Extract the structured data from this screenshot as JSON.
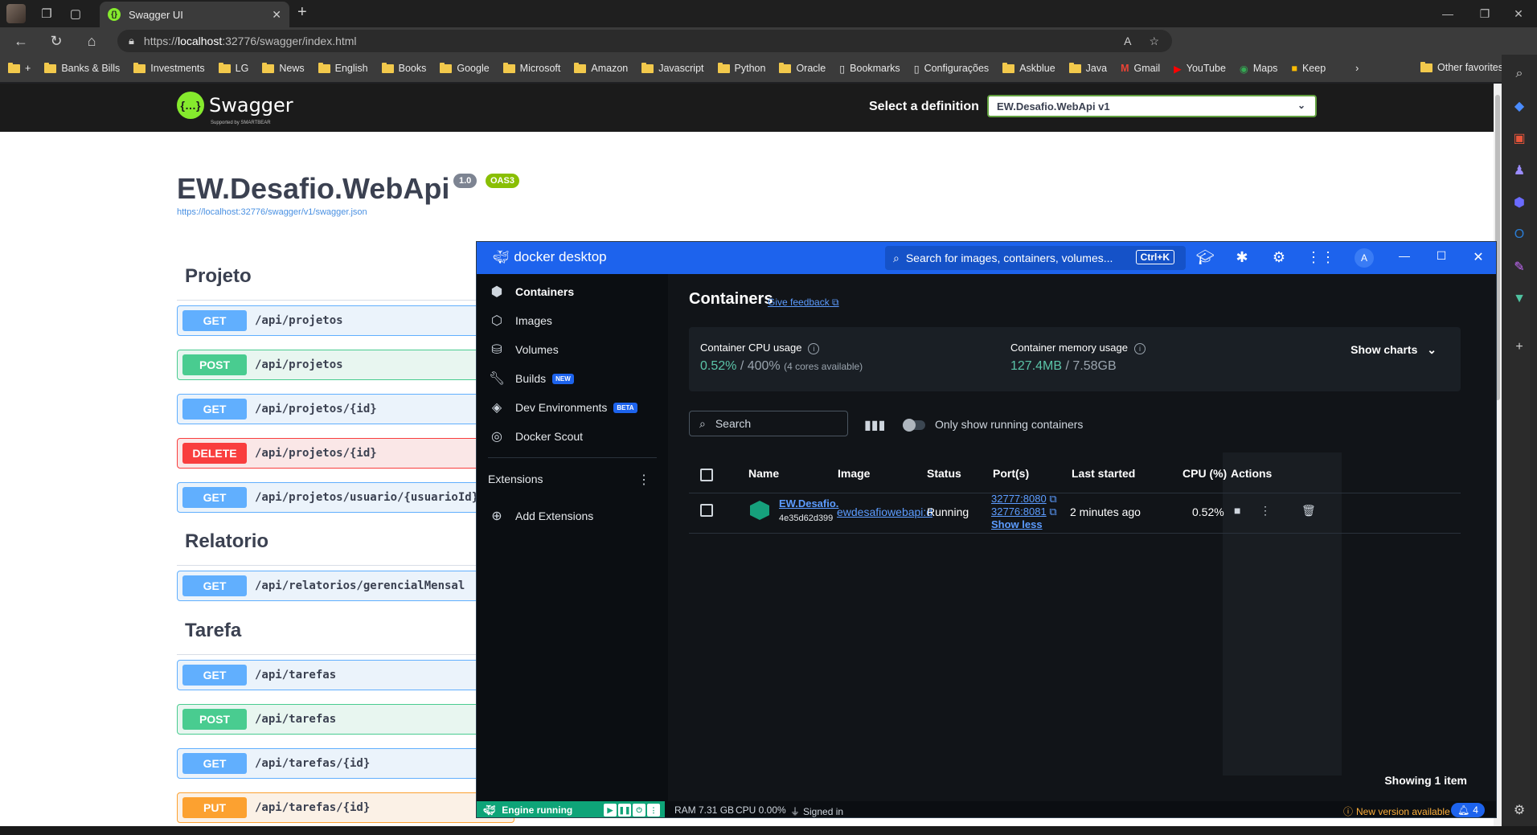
{
  "browser": {
    "tab_title": "Swagger UI",
    "url_prefix": "https://",
    "url_host": "localhost",
    "url_rest": ":32776/swagger/index.html",
    "bookmarks": [
      "Banks & Bills",
      "Investments",
      "LG",
      "News",
      "English",
      "Books",
      "Google",
      "Microsoft",
      "Amazon",
      "Javascript",
      "Python",
      "Oracle",
      "Bookmarks",
      "Configurações",
      "Askblue",
      "Java",
      "Gmail",
      "YouTube",
      "Maps",
      "Keep"
    ],
    "bookmarks_add": "+",
    "other_favorites": "Other favorites"
  },
  "swagger": {
    "logo_text": "Swagger",
    "logo_sub": "Supported by SMARTBEAR",
    "select_label": "Select a definition",
    "select_value": "EW.Desafio.WebApi v1",
    "api_title": "EW.Desafio.WebApi",
    "version_badge": "1.0",
    "oas_badge": "OAS3",
    "spec_link": "https://localhost:32776/swagger/v1/swagger.json",
    "tags": [
      "Projeto",
      "Relatorio",
      "Tarefa"
    ],
    "ops": [
      {
        "method": "GET",
        "path": "/api/projetos"
      },
      {
        "method": "POST",
        "path": "/api/projetos"
      },
      {
        "method": "GET",
        "path": "/api/projetos/{id}"
      },
      {
        "method": "DELETE",
        "path": "/api/projetos/{id}"
      },
      {
        "method": "GET",
        "path": "/api/projetos/usuario/{usuarioId}"
      },
      {
        "method": "GET",
        "path": "/api/relatorios/gerencialMensal"
      },
      {
        "method": "GET",
        "path": "/api/tarefas"
      },
      {
        "method": "POST",
        "path": "/api/tarefas"
      },
      {
        "method": "GET",
        "path": "/api/tarefas/{id}"
      },
      {
        "method": "PUT",
        "path": "/api/tarefas/{id}"
      }
    ]
  },
  "docker": {
    "brand": "docker desktop",
    "search_placeholder": "Search for images, containers, volumes...",
    "search_shortcut": "Ctrl+K",
    "avatar_letter": "A",
    "nav": {
      "containers": "Containers",
      "images": "Images",
      "volumes": "Volumes",
      "builds": "Builds",
      "builds_badge": "NEW",
      "dev_env": "Dev Environments",
      "dev_env_badge": "BETA",
      "scout": "Docker Scout",
      "extensions": "Extensions",
      "add_extensions": "Add Extensions"
    },
    "page_title": "Containers",
    "feedback": "Give feedback",
    "cpu_label": "Container CPU usage",
    "cpu_value": "0.52%",
    "cpu_total": "400%",
    "cpu_note": "(4 cores available)",
    "mem_label": "Container memory usage",
    "mem_value": "127.4MB",
    "mem_total": "7.58GB",
    "show_charts": "Show charts",
    "search": "Search",
    "only_running": "Only show running containers",
    "columns": {
      "name": "Name",
      "image": "Image",
      "status": "Status",
      "ports": "Port(s)",
      "last_started": "Last started",
      "cpu": "CPU (%)",
      "actions": "Actions"
    },
    "container": {
      "name": "EW.Desafio.",
      "id": "4e35d62d399",
      "image": "ewdesafiowebapi:d",
      "status": "Running",
      "port1": "32777:8080",
      "port2": "32776:8081",
      "show_less": "Show less",
      "last_started": "2 minutes ago",
      "cpu": "0.52%"
    },
    "showing": "Showing 1 item",
    "footer": {
      "engine": "Engine running",
      "ram": "RAM 7.31 GB",
      "cpu": "CPU 0.00%",
      "signed": "Signed in",
      "new_version": "New version available",
      "notifications": "4"
    }
  }
}
